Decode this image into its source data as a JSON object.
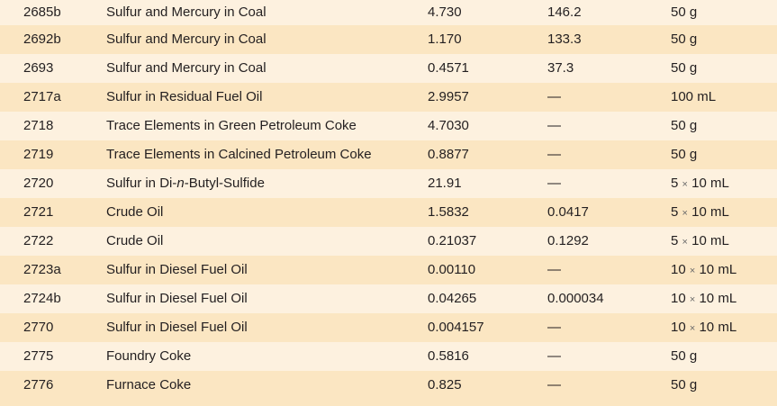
{
  "rows": [
    {
      "id": "2685b",
      "name": "Sulfur and Mercury in Coal",
      "sulfur": "4.730",
      "mercury": "146.2",
      "unit": "50 g"
    },
    {
      "id": "2692b",
      "name": "Sulfur and Mercury in Coal",
      "sulfur": "1.170",
      "mercury": "133.3",
      "unit": "50 g"
    },
    {
      "id": "2693",
      "name": "Sulfur and Mercury in Coal",
      "sulfur": "0.4571",
      "mercury": "37.3",
      "unit": "50 g"
    },
    {
      "id": "2717a",
      "name": "Sulfur in Residual Fuel Oil",
      "sulfur": "2.9957",
      "mercury": "—",
      "unit": "100 mL"
    },
    {
      "id": "2718",
      "name": "Trace Elements in Green Petroleum Coke",
      "sulfur": "4.7030",
      "mercury": "—",
      "unit": "50 g"
    },
    {
      "id": "2719",
      "name": "Trace Elements in Calcined Petroleum Coke",
      "sulfur": "0.8877",
      "mercury": "—",
      "unit": "50 g"
    },
    {
      "id": "2720",
      "name_pre": "Sulfur in Di-",
      "name_ital": "n",
      "name_post": "-Butyl-Sulfide",
      "sulfur": "21.91",
      "mercury": "—",
      "unit_count": "5",
      "unit_sep": "×",
      "unit_size": "10 mL"
    },
    {
      "id": "2721",
      "name": "Crude Oil",
      "sulfur": "1.5832",
      "mercury": "0.0417",
      "unit_count": "5",
      "unit_sep": "×",
      "unit_size": "10 mL"
    },
    {
      "id": "2722",
      "name": "Crude Oil",
      "sulfur": "0.21037",
      "mercury": "0.1292",
      "unit_count": "5",
      "unit_sep": "×",
      "unit_size": "10 mL"
    },
    {
      "id": "2723a",
      "name": "Sulfur in Diesel Fuel Oil",
      "sulfur": "0.00110",
      "mercury": "—",
      "unit_count": "10",
      "unit_sep": "×",
      "unit_size": "10 mL"
    },
    {
      "id": "2724b",
      "name": "Sulfur in Diesel Fuel Oil",
      "sulfur": "0.04265",
      "mercury": "0.000034",
      "unit_count": "10",
      "unit_sep": "×",
      "unit_size": "10 mL"
    },
    {
      "id": "2770",
      "name": "Sulfur in Diesel Fuel Oil",
      "sulfur": "0.004157",
      "mercury": "—",
      "unit_count": "10",
      "unit_sep": "×",
      "unit_size": "10 mL"
    },
    {
      "id": "2775",
      "name": "Foundry Coke",
      "sulfur": "0.5816",
      "mercury": "—",
      "unit": "50 g"
    },
    {
      "id": "2776",
      "name": "Furnace Coke",
      "sulfur": "0.825",
      "mercury": "—",
      "unit": "50 g"
    }
  ]
}
